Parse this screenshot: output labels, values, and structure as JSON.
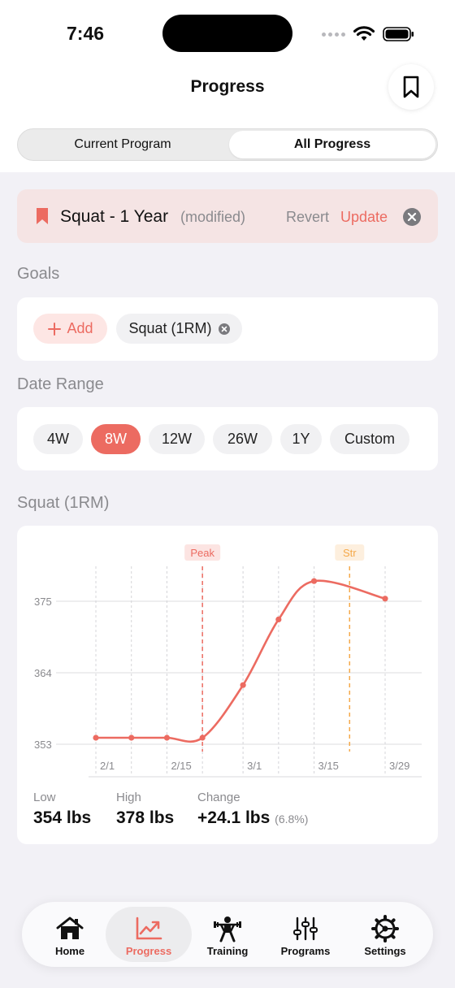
{
  "status_bar": {
    "time": "7:46"
  },
  "header": {
    "title": "Progress"
  },
  "segmented": {
    "left_label": "Current Program",
    "right_label": "All Progress",
    "selected": "All Progress"
  },
  "program": {
    "name": "Squat - 1 Year",
    "modified": "(modified)",
    "revert_label": "Revert",
    "update_label": "Update"
  },
  "goals": {
    "section_title": "Goals",
    "add_label": "Add",
    "items": [
      "Squat (1RM)"
    ]
  },
  "date_range": {
    "section_title": "Date Range",
    "options": [
      "4W",
      "8W",
      "12W",
      "26W",
      "1Y",
      "Custom"
    ],
    "selected": "8W"
  },
  "chart_section": {
    "title": "Squat (1RM)"
  },
  "chart_data": {
    "type": "line",
    "title": "Squat (1RM)",
    "x_tick_labels": [
      "2/1",
      "2/15",
      "3/1",
      "3/15",
      "3/29"
    ],
    "y_tick_labels": [
      "353",
      "364",
      "375"
    ],
    "ylim": [
      353,
      375
    ],
    "points": [
      {
        "x": "2/1",
        "y": 354.0
      },
      {
        "x": "2/8",
        "y": 354.0
      },
      {
        "x": "2/15",
        "y": 354.0
      },
      {
        "x": "2/22",
        "y": 354.0
      },
      {
        "x": "3/1",
        "y": 362.1
      },
      {
        "x": "3/8",
        "y": 372.2
      },
      {
        "x": "3/15",
        "y": 378.1
      },
      {
        "x": "3/29",
        "y": 375.4
      }
    ],
    "markers": [
      {
        "label": "Peak",
        "x": "2/22",
        "color": "#ec6b61"
      },
      {
        "label": "Str",
        "x": "3/22",
        "color": "#f5a94a"
      }
    ],
    "line_color": "#ec6b61",
    "grid": true
  },
  "stats": {
    "low_label": "Low",
    "low_value": "354 lbs",
    "high_label": "High",
    "high_value": "378 lbs",
    "change_label": "Change",
    "change_value": "+24.1 lbs",
    "change_pct": "(6.8%)"
  },
  "tabbar": {
    "items": [
      {
        "label": "Home",
        "icon": "home-icon"
      },
      {
        "label": "Progress",
        "icon": "chart-icon"
      },
      {
        "label": "Training",
        "icon": "weightlifter-icon"
      },
      {
        "label": "Programs",
        "icon": "sliders-icon"
      },
      {
        "label": "Settings",
        "icon": "gear-icon"
      }
    ],
    "selected": "Progress"
  },
  "colors": {
    "accent": "#ec6b61",
    "accent_soft": "#fde6e4",
    "marker_orange": "#f5a94a"
  }
}
